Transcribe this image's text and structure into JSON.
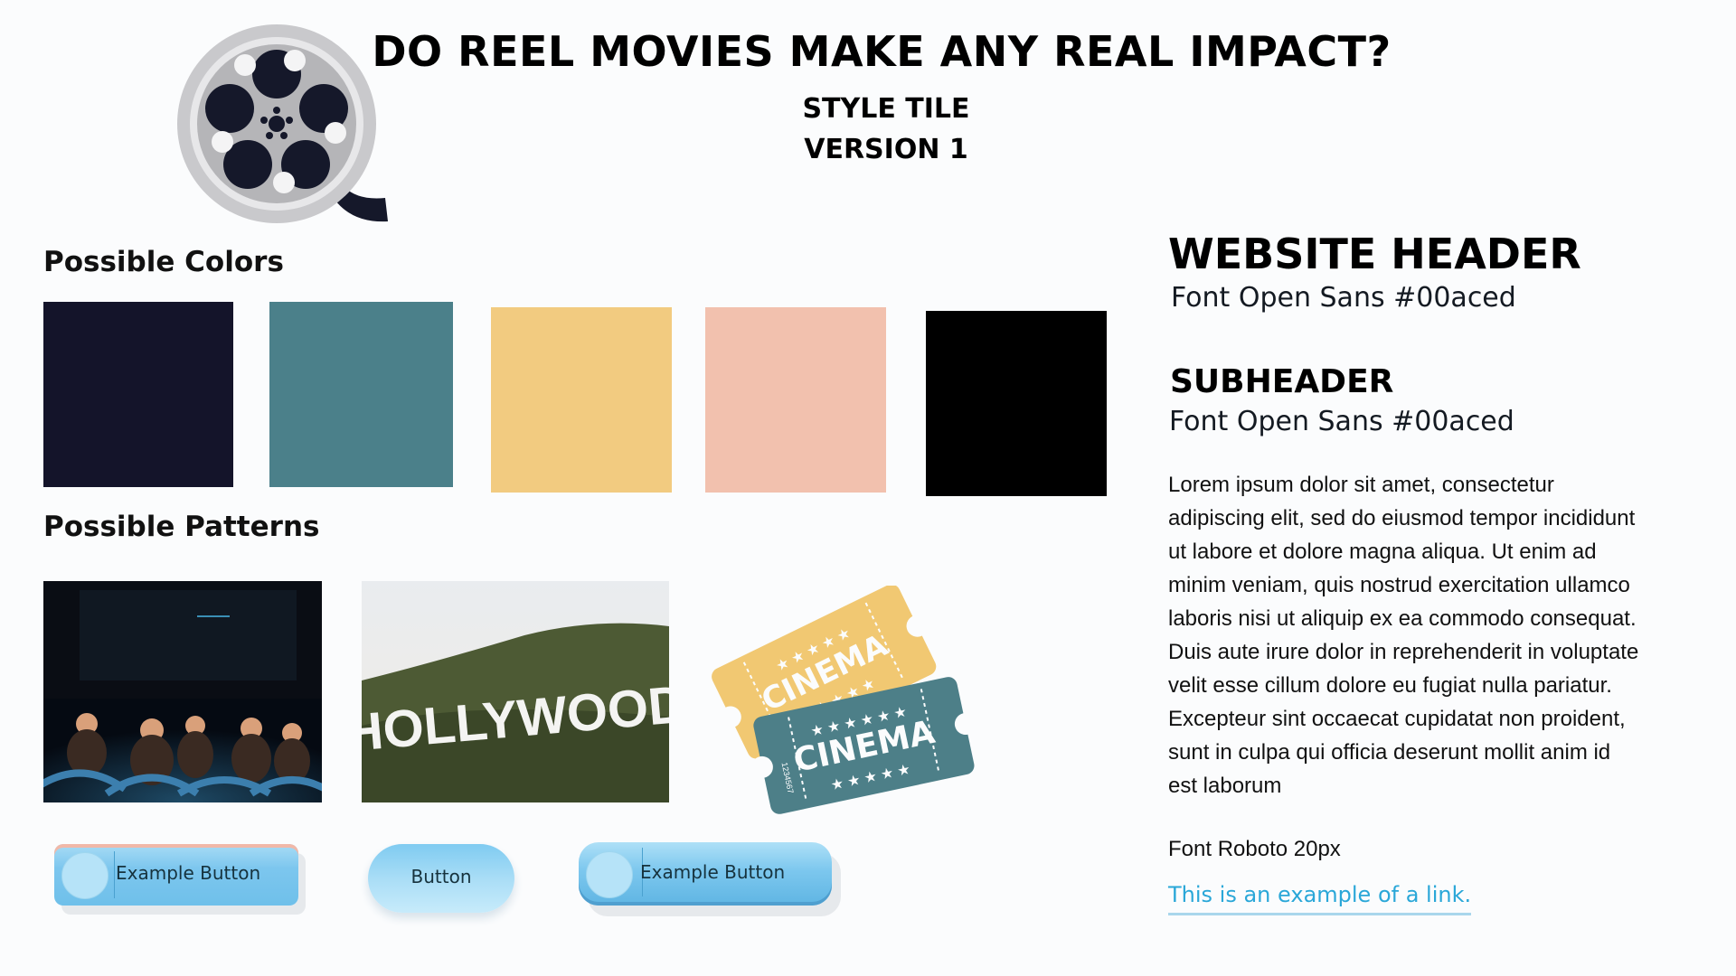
{
  "header": {
    "title": "DO REEL MOVIES MAKE ANY REAL IMPACT?",
    "subtitle_line1": "STYLE TILE",
    "subtitle_line2": "VERSION 1"
  },
  "colors_section": {
    "heading": "Possible Colors",
    "swatches": [
      "#14142a",
      "#4b808a",
      "#f2cb80",
      "#f2c1ae",
      "#000000"
    ]
  },
  "patterns_section": {
    "heading": "Possible Patterns",
    "hollywood_sign_text": "HOLLYWOOD",
    "ticket_text": "CINEMA",
    "ticket_serial": "1234567"
  },
  "buttons": {
    "button1_label": "Example Button",
    "button2_label": "Button",
    "button3_label": "Example Button"
  },
  "typography": {
    "website_header": "WEBSITE HEADER",
    "website_header_note": "Font Open Sans  #00aced",
    "subheader": "SUBHEADER",
    "subheader_note": "Font Open Sans #00aced",
    "lorem_lines": [
      "Lorem ipsum dolor sit amet, consectetur",
      "adipiscing elit, sed do eiusmod tempor incididunt",
      "ut labore et dolore magna aliqua. Ut enim ad",
      "minim veniam, quis nostrud exercitation ullamco",
      "laboris nisi ut aliquip ex ea commodo consequat.",
      "Duis aute irure dolor in reprehenderit in voluptate",
      "velit esse cillum dolore eu fugiat nulla pariatur.",
      "Excepteur sint occaecat cupidatat non proident,",
      "sunt in culpa qui officia deserunt mollit anim id",
      "est laborum"
    ],
    "body_font_note": "Font Roboto 20px",
    "link_text": "This is an example of a link."
  },
  "icons": {
    "reel": "film-reel-icon",
    "tickets": "cinema-tickets-icon"
  }
}
